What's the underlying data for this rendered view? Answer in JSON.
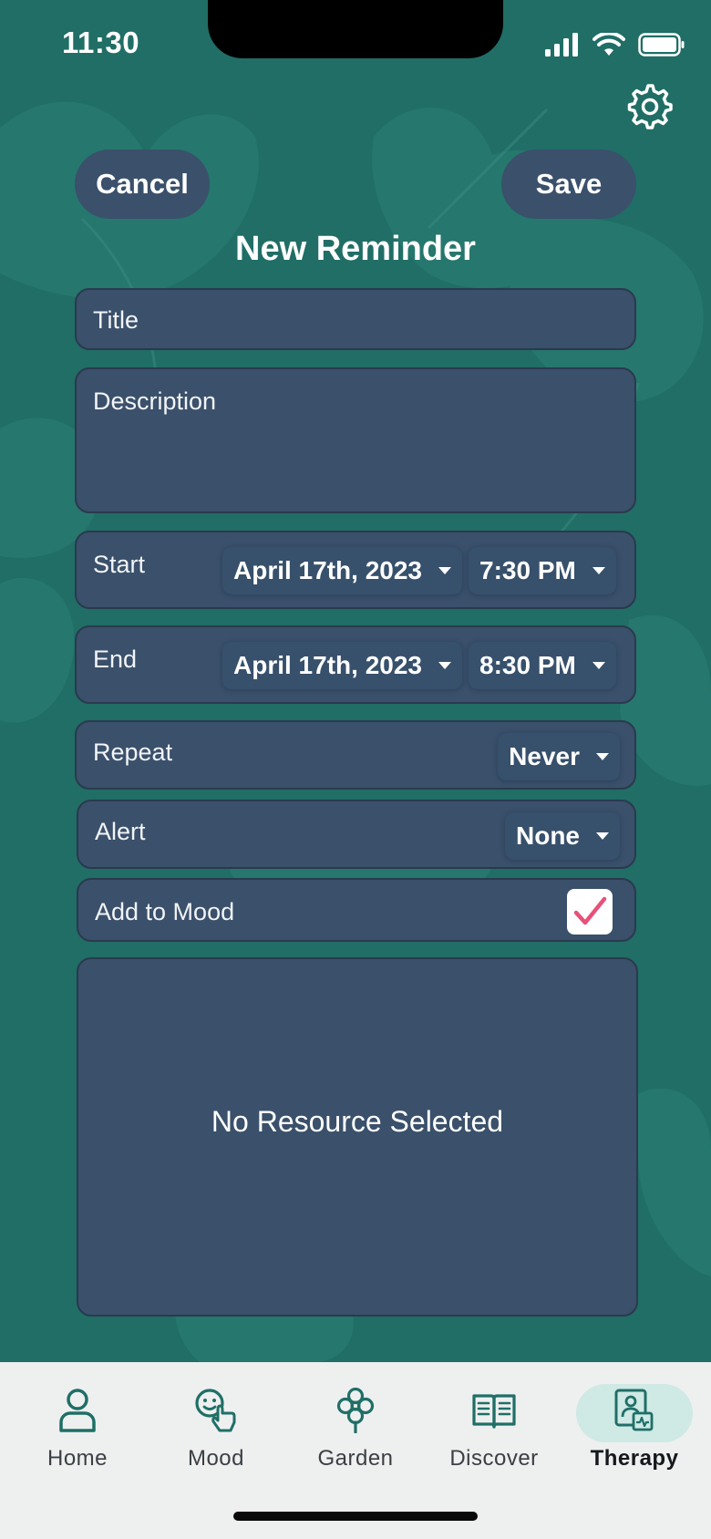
{
  "status_bar": {
    "time": "11:30"
  },
  "header": {
    "cancel_label": "Cancel",
    "save_label": "Save",
    "title": "New Reminder"
  },
  "form": {
    "title_placeholder": "Title",
    "description_placeholder": "Description",
    "start": {
      "label": "Start",
      "date": "April 17th, 2023",
      "time": "7:30 PM"
    },
    "end": {
      "label": "End",
      "date": "April 17th, 2023",
      "time": "8:30 PM"
    },
    "repeat": {
      "label": "Repeat",
      "value": "Never"
    },
    "alert": {
      "label": "Alert",
      "value": "None"
    },
    "add_to_mood": {
      "label": "Add to Mood",
      "checked": true
    },
    "resource": {
      "empty_text": "No Resource Selected"
    }
  },
  "tabs": [
    {
      "label": "Home",
      "icon": "person-icon",
      "active": false
    },
    {
      "label": "Mood",
      "icon": "mood-icon",
      "active": false
    },
    {
      "label": "Garden",
      "icon": "flower-icon",
      "active": false
    },
    {
      "label": "Discover",
      "icon": "book-icon",
      "active": false
    },
    {
      "label": "Therapy",
      "icon": "therapy-icon",
      "active": true
    }
  ],
  "colors": {
    "background": "#206e66",
    "field": "#3a506b",
    "tabbar": "#eef0ef",
    "tab_active_highlight": "#cfe9e5",
    "checkmark": "#e8507a"
  }
}
